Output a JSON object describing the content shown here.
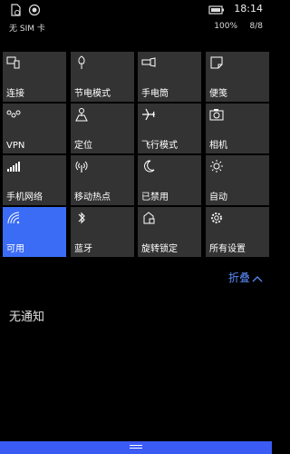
{
  "status": {
    "time": "18:14"
  },
  "info": {
    "carrier": "无 SIM 卡",
    "battery": "100%",
    "page": "8/8"
  },
  "tiles": [
    {
      "label": "连接",
      "icon": "connect-icon"
    },
    {
      "label": "节电模式",
      "icon": "battery-saver-icon"
    },
    {
      "label": "手电筒",
      "icon": "flashlight-icon"
    },
    {
      "label": "便笺",
      "icon": "note-icon"
    },
    {
      "label": "VPN",
      "icon": "vpn-icon"
    },
    {
      "label": "定位",
      "icon": "location-icon"
    },
    {
      "label": "飞行模式",
      "icon": "airplane-icon"
    },
    {
      "label": "相机",
      "icon": "camera-icon"
    },
    {
      "label": "手机网络",
      "icon": "cellular-icon"
    },
    {
      "label": "移动热点",
      "icon": "hotspot-icon"
    },
    {
      "label": "已禁用",
      "icon": "moon-icon"
    },
    {
      "label": "自动",
      "icon": "brightness-icon"
    },
    {
      "label": "可用",
      "icon": "wifi-icon",
      "active": true
    },
    {
      "label": "蓝牙",
      "icon": "bluetooth-icon"
    },
    {
      "label": "旋转锁定",
      "icon": "rotation-lock-icon"
    },
    {
      "label": "所有设置",
      "icon": "settings-icon"
    }
  ],
  "collapse_label": "折叠",
  "notifications_empty": "无通知",
  "colors": {
    "accent": "#3b6cf5",
    "tile": "#333333",
    "link": "#5b8cf8"
  }
}
